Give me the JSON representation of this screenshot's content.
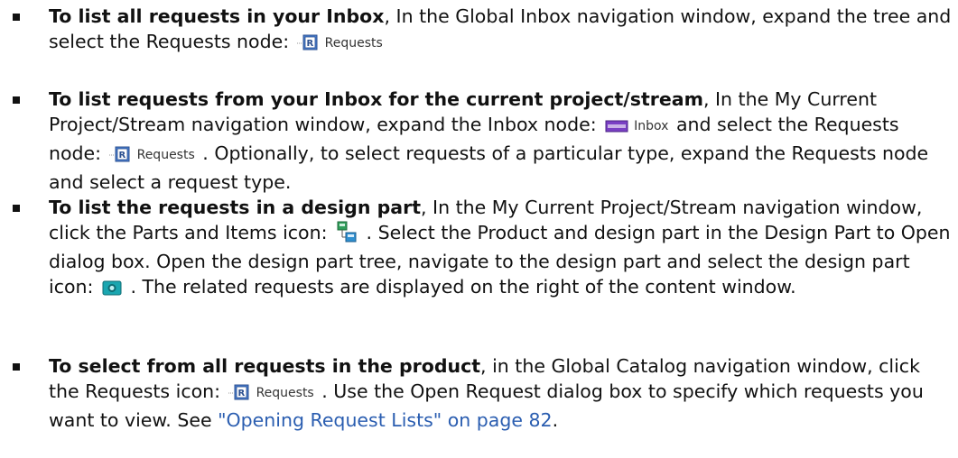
{
  "items": [
    {
      "lead": "To list all requests in your Inbox",
      "text_1": ", In the Global Inbox navigation window, expand the tree and select the Requests node: ",
      "icon_1": "requests-node-icon",
      "icon_1_label": "Requests",
      "text_2": ""
    },
    {
      "lead": "To list requests from your Inbox for the current project/stream",
      "text_1": ", In the My Current Project/Stream navigation window, expand the Inbox node: ",
      "icon_1": "inbox-node-icon",
      "icon_1_label": "Inbox",
      "text_2": " and select the Requests node: ",
      "icon_2": "requests-node-icon",
      "icon_2_label": "Requests",
      "text_3": " . Optionally, to select requests of a particular type, expand the Requests node and select a request type."
    },
    {
      "lead": "To list the requests in a design part",
      "text_1": ", In the My Current Project/Stream navigation window, click the Parts and Items icon: ",
      "icon_1": "parts-and-items-icon",
      "text_2": " . Select the Product and design part in the Design Part to Open dialog box. Open the design part tree, navigate to the design part and select the design part icon: ",
      "icon_2": "design-part-icon",
      "text_3": " . The related requests are displayed on the right of the content window."
    },
    {
      "lead": "To select from all requests in the product",
      "text_1": ", in the Global Catalog navigation window, click the Requests icon: ",
      "icon_1": "requests-node-icon",
      "icon_1_label": "Requests",
      "text_2": " . Use the Open Request dialog box to specify which requests you want to view. See ",
      "link": "\"Opening Request Lists\" on page 82",
      "text_3": "."
    }
  ],
  "colors": {
    "text": "#111111",
    "link": "#2a5db0",
    "requests_icon": "#4a7fd0",
    "inbox_icon": "#7a3fc4",
    "parts_icon": "#2f9e5a",
    "design_part_icon": "#1aa6b0"
  }
}
